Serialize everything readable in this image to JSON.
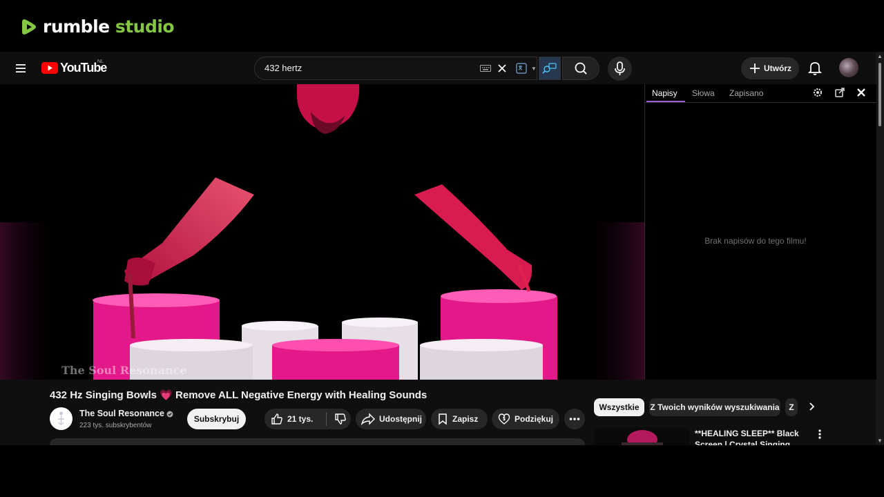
{
  "rumble": {
    "word1": "rumble",
    "word2": "studio"
  },
  "youtube": {
    "logo_text": "YouTube",
    "region": "NL",
    "search": {
      "value": "432 hertz"
    },
    "create_label": "Utwórz"
  },
  "transcript": {
    "tabs": [
      "Napisy",
      "Słowa",
      "Zapisano"
    ],
    "empty_message": "Brak napisów do tego filmu!"
  },
  "video": {
    "watermark": "The Soul Resonance",
    "title": "432 Hz Singing Bowls 💗 Remove ALL Negative Energy with Healing Sounds",
    "channel_name": "The Soul Resonance",
    "subscribers": "223 tys. subskrybentów",
    "subscribe_label": "Subskrybuj",
    "likes": "21 tys.",
    "share_label": "Udostępnij",
    "save_label": "Zapisz",
    "thanks_label": "Podziękuj"
  },
  "sidebar": {
    "chips": [
      "Wszystkie",
      "Z Twoich wyników wyszukiwania",
      "Z"
    ],
    "related_title": "**HEALING SLEEP** Black Screen | Crystal Singing Bowls"
  },
  "colors": {
    "rumble_green": "#85c742",
    "youtube_red": "#ff0000",
    "bowl_pink": "#e8198b",
    "transcript_accent": "#9b5bd1"
  }
}
